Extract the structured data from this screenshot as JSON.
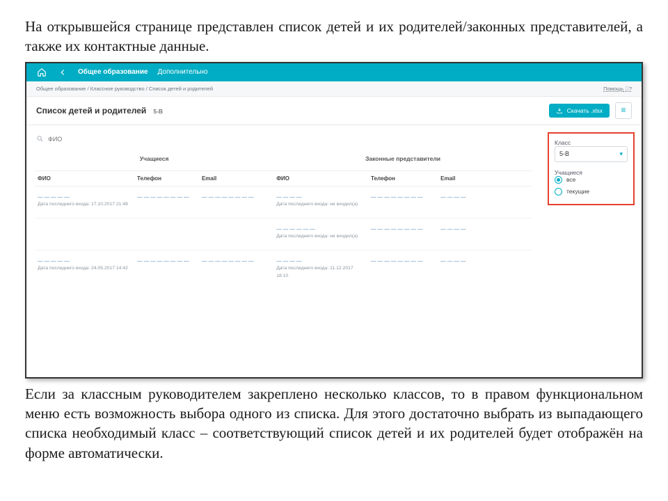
{
  "doc": {
    "para_top": "На открывшейся странице представлен список детей и их родителей/законных представителей, а также их контактные данные.",
    "para_bottom": "Если за классным руководителем закреплено несколько классов, то в правом функциональном меню есть возможность выбора одного из списка. Для этого достаточно выбрать из выпадающего списка необходимый класс – соответствующий список детей и их родителей будет отображён на форме автоматически."
  },
  "topbar": {
    "nav_main": "Общее образование",
    "nav_extra": "Дополнительно"
  },
  "breadcrumb": {
    "path": "Общее образование / Классное руководство / Список детей и родителей",
    "help": "Помощь"
  },
  "title": {
    "heading": "Список детей и родителей",
    "badge": "5-В",
    "download": "Скачать .xlsx"
  },
  "search": {
    "placeholder": "ФИО"
  },
  "table": {
    "group_students": "Учащиеся",
    "group_reps": "Законные представители",
    "cols": {
      "fio": "ФИО",
      "phone": "Телефон",
      "email": "Email",
      "rfio": "ФИО",
      "rphone": "Телефон",
      "remail": "Email"
    },
    "rows": [
      {
        "fio": "— — — — —",
        "fio_sub": "Дата последнего входа: 17.10.2017 21:48",
        "phone": "— — — —\n— — — —",
        "email": "— — — —\n— — — —",
        "rfio": "— — — —",
        "rfio_sub": "Дата последнего входа: не входил(а)",
        "rphone": "— — — —\n— — — —",
        "remail": "— — — —"
      },
      {
        "fio": "",
        "fio_sub": "",
        "phone": "",
        "email": "",
        "rfio": "— — — — — —",
        "rfio_sub": "Дата последнего входа: не входил(а)",
        "rphone": "— — — —\n— — — —",
        "remail": "— — — —"
      },
      {
        "fio": "— — — — —",
        "fio_sub": "Дата последнего входа: 24.05.2017 14:42",
        "phone": "— — — —\n— — — —",
        "email": "— — — —\n— — — —",
        "rfio": "— — — —",
        "rfio_sub": "Дата последнего входа: 11.12.2017 18:10",
        "rphone": "— — — —\n— — — —",
        "remail": "— — — —"
      }
    ]
  },
  "side": {
    "class_label": "Класс",
    "class_value": "5-В",
    "students_label": "Учащиеся",
    "radio_all": "все",
    "radio_current": "текущие"
  }
}
